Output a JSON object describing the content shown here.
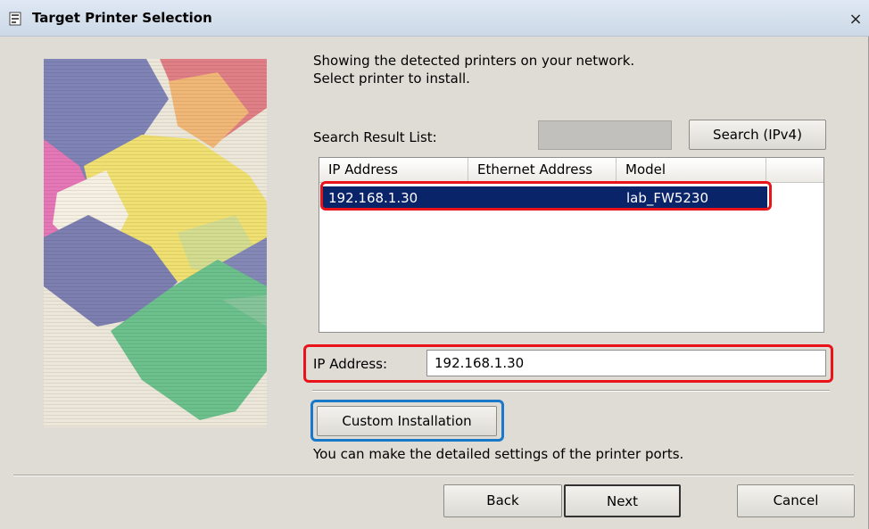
{
  "window": {
    "title": "Target Printer Selection",
    "close_glyph": "×"
  },
  "intro": {
    "line1": "Showing the detected printers on your network.",
    "line2": "Select printer to install."
  },
  "search": {
    "list_label": "Search Result List:",
    "field_value": "",
    "button_label": "Search (IPv4)"
  },
  "results": {
    "columns": [
      "IP Address",
      "Ethernet Address",
      "Model"
    ],
    "rows": [
      {
        "ip": "192.168.1.30",
        "ethernet": "",
        "model": "lab_FW5230",
        "selected": true
      }
    ]
  },
  "ip_field": {
    "label": "IP Address:",
    "value": "192.168.1.30"
  },
  "custom": {
    "button_label": "Custom Installation",
    "description": "You can make the detailed settings of the printer ports."
  },
  "footer": {
    "back": "Back",
    "next": "Next",
    "cancel": "Cancel"
  },
  "colors": {
    "selection": "#0a246a",
    "highlight_red": "#e8141a",
    "highlight_blue": "#1a78c8",
    "dialog_bg": "#dfdcd5"
  },
  "icons": {
    "title_icon": "printer-setup-icon",
    "close": "close-icon"
  }
}
